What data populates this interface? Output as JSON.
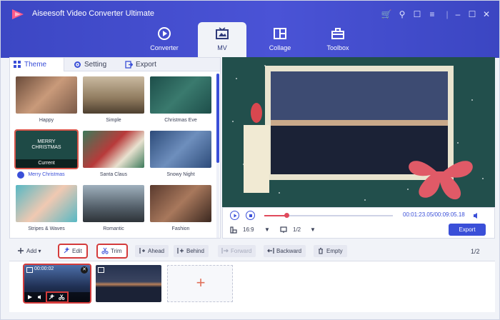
{
  "app": {
    "title": "Aiseesoft Video Converter Ultimate"
  },
  "nav": [
    {
      "id": "converter",
      "label": "Converter",
      "icon": "converter-icon"
    },
    {
      "id": "mv",
      "label": "MV",
      "icon": "mv-icon",
      "active": true
    },
    {
      "id": "collage",
      "label": "Collage",
      "icon": "collage-icon"
    },
    {
      "id": "toolbox",
      "label": "Toolbox",
      "icon": "toolbox-icon"
    }
  ],
  "tabs": [
    {
      "label": "Theme",
      "icon": "grid-icon",
      "active": true
    },
    {
      "label": "Setting",
      "icon": "gear-icon"
    },
    {
      "label": "Export",
      "icon": "export-icon"
    }
  ],
  "themes": [
    {
      "name": "Happy"
    },
    {
      "name": "Simple"
    },
    {
      "name": "Christmas Eve"
    },
    {
      "name": "Merry Christmas",
      "selected": true,
      "tag": "Current",
      "thumb_text": "MERRY CHRISTMAS"
    },
    {
      "name": "Santa Claus"
    },
    {
      "name": "Snowy Night"
    },
    {
      "name": "Stripes & Waves"
    },
    {
      "name": "Romantic"
    },
    {
      "name": "Fashion"
    }
  ],
  "player": {
    "time": "00:01:23.05/00:09:05.18",
    "progress": 0.17,
    "aspect": "16:9",
    "page": "1/2",
    "export_label": "Export"
  },
  "toolbar": {
    "add": "Add",
    "edit": "Edit",
    "trim": "Trim",
    "ahead": "Ahead",
    "behind": "Behind",
    "forward": "Forward",
    "backward": "Backward",
    "empty": "Empty",
    "pager": "1/2"
  },
  "timeline": {
    "clip1_time": "00:00:02",
    "add_symbol": "+"
  },
  "colors": {
    "accent": "#3a4fd8",
    "highlight": "#d43b3b",
    "header": "#4a53d6"
  }
}
